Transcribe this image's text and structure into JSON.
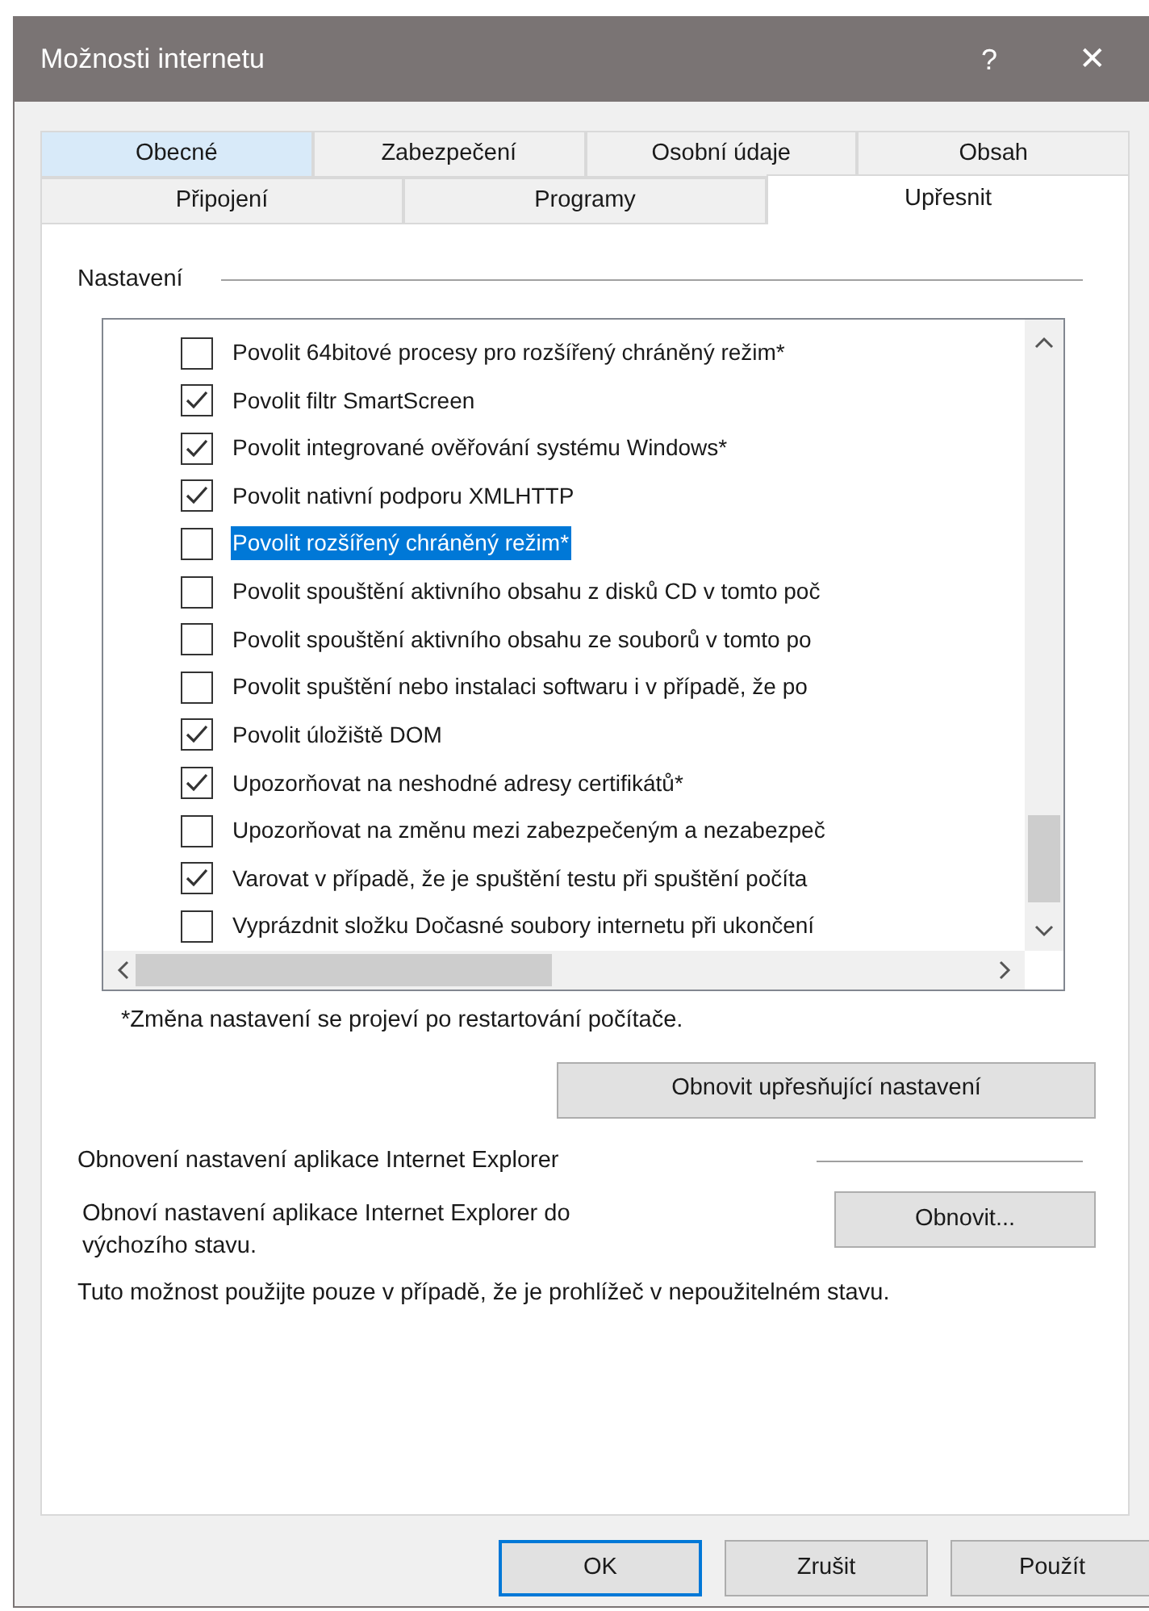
{
  "window": {
    "title": "Možnosti internetu",
    "help": "?",
    "close": "✕"
  },
  "tab_rows": [
    [
      {
        "label": "Obecné",
        "selected": false,
        "hovered": true
      },
      {
        "label": "Zabezpečení",
        "selected": false,
        "hovered": false
      },
      {
        "label": "Osobní údaje",
        "selected": false,
        "hovered": false
      },
      {
        "label": "Obsah",
        "selected": false,
        "hovered": false
      }
    ],
    [
      {
        "label": "Připojení",
        "selected": false,
        "hovered": false
      },
      {
        "label": "Programy",
        "selected": false,
        "hovered": false
      },
      {
        "label": "Upřesnit",
        "selected": true,
        "hovered": false
      }
    ]
  ],
  "settings": {
    "title": "Nastavení",
    "items": [
      {
        "label": "Povolit 64bitové procesy pro rozšířený chráněný režim*",
        "checked": false,
        "selected": false
      },
      {
        "label": "Povolit filtr SmartScreen",
        "checked": true,
        "selected": false
      },
      {
        "label": "Povolit integrované ověřování systému Windows*",
        "checked": true,
        "selected": false
      },
      {
        "label": "Povolit nativní podporu XMLHTTP",
        "checked": true,
        "selected": false
      },
      {
        "label": "Povolit rozšířený chráněný režim*",
        "checked": false,
        "selected": true
      },
      {
        "label": "Povolit spouštění aktivního obsahu z disků CD v tomto poč",
        "checked": false,
        "selected": false
      },
      {
        "label": "Povolit spouštění aktivního obsahu ze souborů v tomto po",
        "checked": false,
        "selected": false
      },
      {
        "label": "Povolit spuštění nebo instalaci softwaru i v případě, že po",
        "checked": false,
        "selected": false
      },
      {
        "label": "Povolit úložiště DOM",
        "checked": true,
        "selected": false
      },
      {
        "label": "Upozorňovat na neshodné adresy certifikátů*",
        "checked": true,
        "selected": false
      },
      {
        "label": "Upozorňovat na změnu mezi zabezpečeným a nezabezpeč",
        "checked": false,
        "selected": false
      },
      {
        "label": "Varovat v případě, že je spuštění testu při spuštění počíta",
        "checked": true,
        "selected": false
      },
      {
        "label": "Vyprázdnit složku Dočasné soubory internetu při ukončení",
        "checked": false,
        "selected": false
      }
    ],
    "footnote": "*Změna nastavení se projeví po restartování počítače.",
    "reset_button": "Obnovit upřesňující nastavení"
  },
  "reset_section": {
    "title": "Obnovení nastavení aplikace Internet Explorer",
    "description": "Obnoví nastavení aplikace Internet Explorer do výchozího stavu.",
    "button": "Obnovit...",
    "note": "Tuto možnost použijte pouze v případě, že je prohlížeč v nepoužitelném stavu."
  },
  "buttons": [
    {
      "label": "OK",
      "default": true
    },
    {
      "label": "Zrušit",
      "default": false
    },
    {
      "label": "Použít",
      "default": false
    }
  ]
}
